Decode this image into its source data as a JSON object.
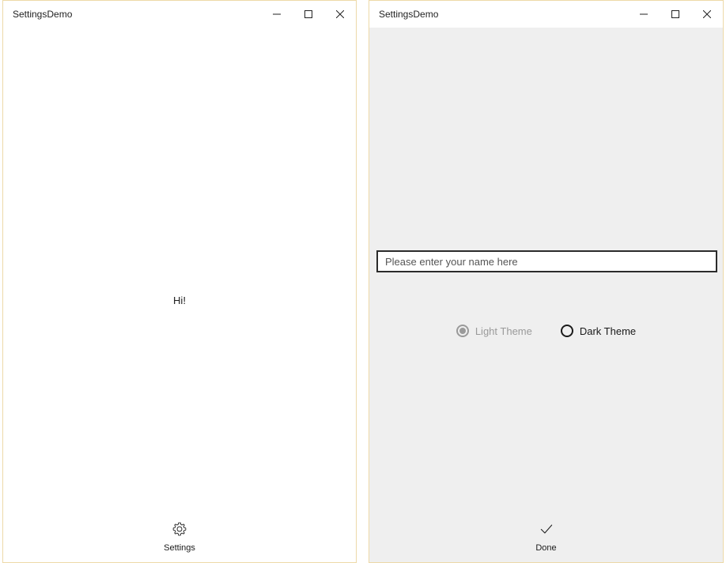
{
  "main_window": {
    "title": "SettingsDemo",
    "greeting": "Hi!",
    "appbar": {
      "settings_label": "Settings"
    }
  },
  "settings_window": {
    "title": "SettingsDemo",
    "name_input": {
      "placeholder": "Please enter your name here",
      "value": ""
    },
    "theme": {
      "light_label": "Light Theme",
      "dark_label": "Dark Theme",
      "selected": "Light Theme",
      "light_enabled": false
    },
    "appbar": {
      "done_label": "Done"
    }
  },
  "icons": {
    "minimize": "minimize-icon",
    "maximize": "maximize-icon",
    "close": "close-icon",
    "settings": "gear-icon",
    "done": "checkmark-icon"
  },
  "colors": {
    "window_border": "#edd9a8",
    "settings_background": "#efefef",
    "disabled_text": "#9a9a9a"
  }
}
